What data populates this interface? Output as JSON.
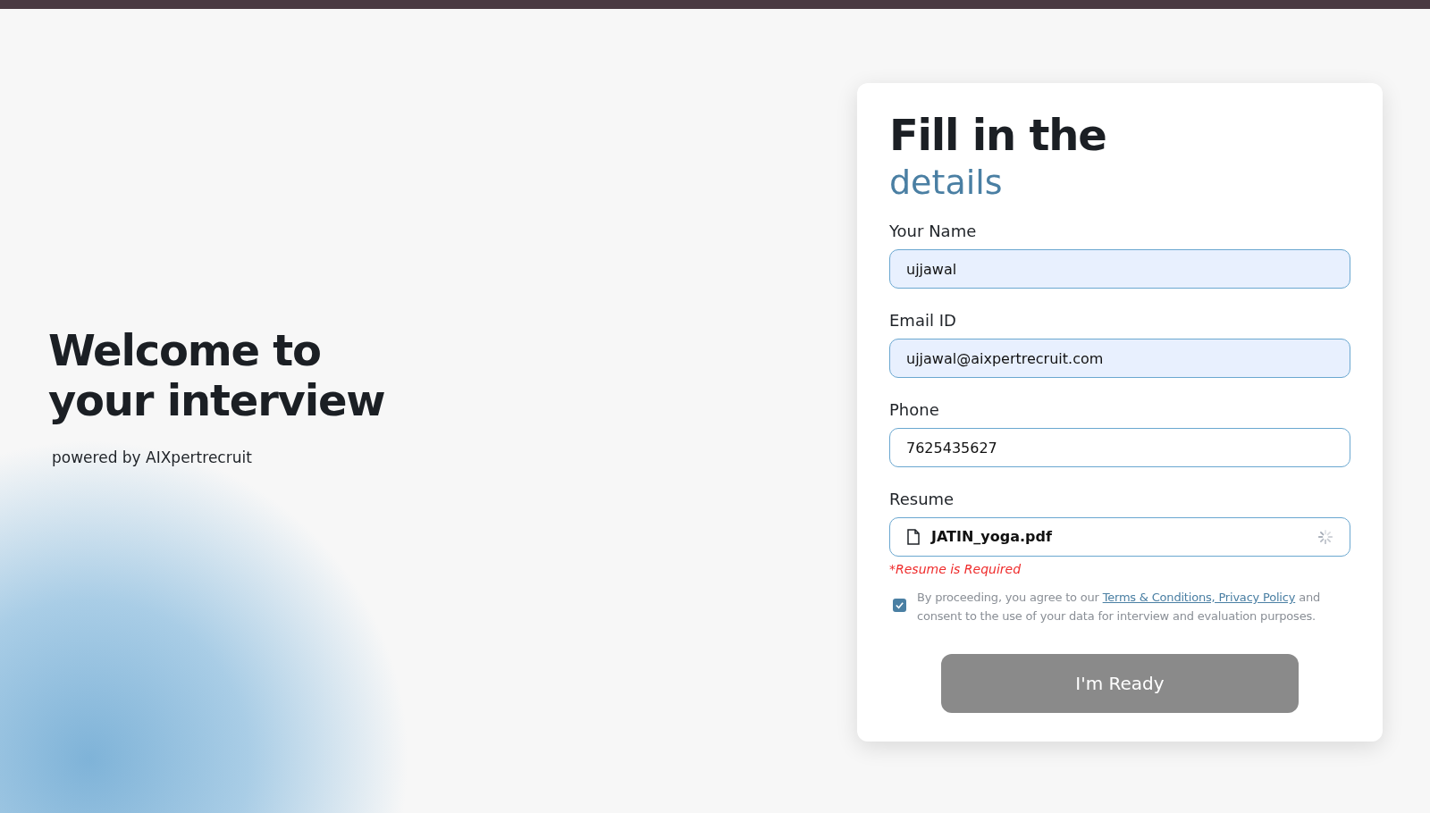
{
  "hero": {
    "title_line_1": "Welcome to",
    "title_line_2": "your interview",
    "subtitle": "powered by AIXpertrecruit"
  },
  "form": {
    "title_line_1": "Fill in the",
    "title_line_2": "details",
    "fields": [
      {
        "kind": "text",
        "label": "Your Name",
        "value": "ujjawal",
        "autofilled": true
      },
      {
        "kind": "text",
        "label": "Email ID",
        "value": "ujjawal@aixpertrecruit.com",
        "autofilled": true
      },
      {
        "kind": "text",
        "label": "Phone",
        "value": "7625435627",
        "autofilled": false
      },
      {
        "kind": "file",
        "label": "Resume",
        "value": "JATIN_yoga.pdf",
        "loading": true,
        "error": "*Resume is Required"
      }
    ],
    "consent": {
      "checked": true,
      "before": "By proceeding, you agree to our",
      "link": "Terms & Conditions, Privacy Policy",
      "after": "and consent to the use of your data for interview and evaluation purposes."
    },
    "submit": {
      "label": "I'm Ready",
      "disabled": true
    }
  }
}
